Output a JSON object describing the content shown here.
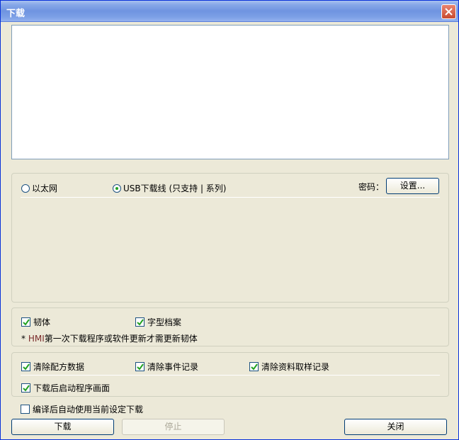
{
  "window": {
    "title": "下载"
  },
  "connection": {
    "ethernet_label": "以太网",
    "usb_label": "USB下载线 (只支持 | 系列)",
    "selected": "usb",
    "password_label": "密码：",
    "settings_button": "设置..."
  },
  "options": {
    "firmware_label": "韧体",
    "font_file_label": "字型档案",
    "note_prefix": "* ",
    "note_hmi": "HMI",
    "note_text": "第一次下载程序或软件更新才需更新韧体",
    "clear_recipe_label": "清除配方数据",
    "clear_events_label": "清除事件记录",
    "clear_sampling_label": "清除资料取样记录",
    "start_after_download_label": "下载后启动程序画面",
    "auto_use_settings_label": "编译后自动使用当前设定下载"
  },
  "checked": {
    "firmware": true,
    "font_file": true,
    "clear_recipe": true,
    "clear_events": true,
    "clear_sampling": true,
    "start_after_download": true,
    "auto_use_settings": false
  },
  "buttons": {
    "download": "下载",
    "stop": "停止",
    "close": "关闭"
  }
}
